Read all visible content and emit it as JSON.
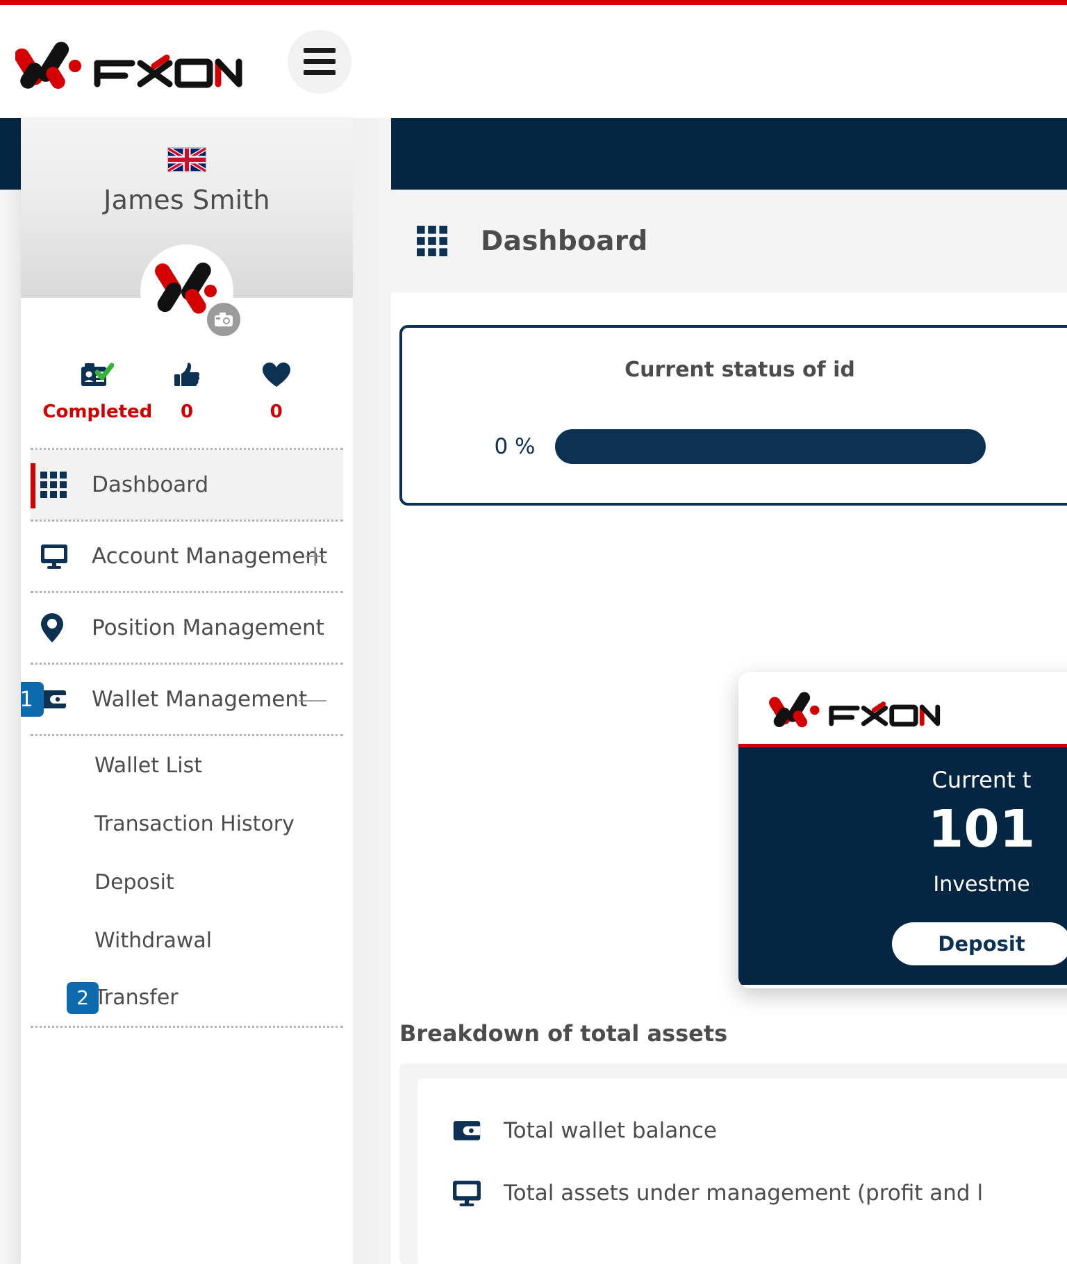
{
  "brand": {
    "name": "FXON",
    "accent_red": "#d40000",
    "navy": "#052642",
    "badge_blue": "#0d6aad"
  },
  "header": {
    "logo_name": "fxon-logo",
    "menu_button_label": "Menu"
  },
  "sidebar": {
    "language_flag": "united-kingdom-flag",
    "user_name": "James Smith",
    "avatar_name": "fxon-avatar",
    "camera_label": "Change photo",
    "stats": [
      {
        "icon": "id-card-verified-icon",
        "value": "Completed"
      },
      {
        "icon": "thumbs-up-icon",
        "value": "0"
      },
      {
        "icon": "heart-icon",
        "value": "0"
      }
    ],
    "nav": [
      {
        "label": "Dashboard",
        "icon": "grid-icon",
        "active": true,
        "expander": ""
      },
      {
        "label": "Account Management",
        "icon": "monitor-icon",
        "active": false,
        "expander": "+"
      },
      {
        "label": "Position Management",
        "icon": "map-pin-icon",
        "active": false,
        "expander": ""
      },
      {
        "label": "Wallet Management",
        "icon": "wallet-icon",
        "active": false,
        "expander": "—",
        "badge": "1"
      }
    ],
    "subnav": [
      {
        "label": "Wallet List"
      },
      {
        "label": "Transaction History"
      },
      {
        "label": "Deposit"
      },
      {
        "label": "Withdrawal"
      },
      {
        "label": "Transfer",
        "badge": "2"
      }
    ]
  },
  "main": {
    "page_title": "Dashboard",
    "page_title_icon": "grid-icon",
    "kyc": {
      "title": "Current status of id",
      "percent_label": "0 %",
      "percent_value": 0,
      "segments": 4
    },
    "total_card": {
      "logo_name": "fxon-logo",
      "label": "Current t",
      "amount": "101",
      "sublabel": "Investme",
      "buttons": [
        {
          "label": "Deposit"
        }
      ]
    },
    "breakdown": {
      "title": "Breakdown of total assets",
      "rows": [
        {
          "icon": "wallet-icon",
          "label": "Total wallet balance"
        },
        {
          "icon": "monitor-icon",
          "label": "Total assets under management (profit and l"
        }
      ]
    }
  }
}
